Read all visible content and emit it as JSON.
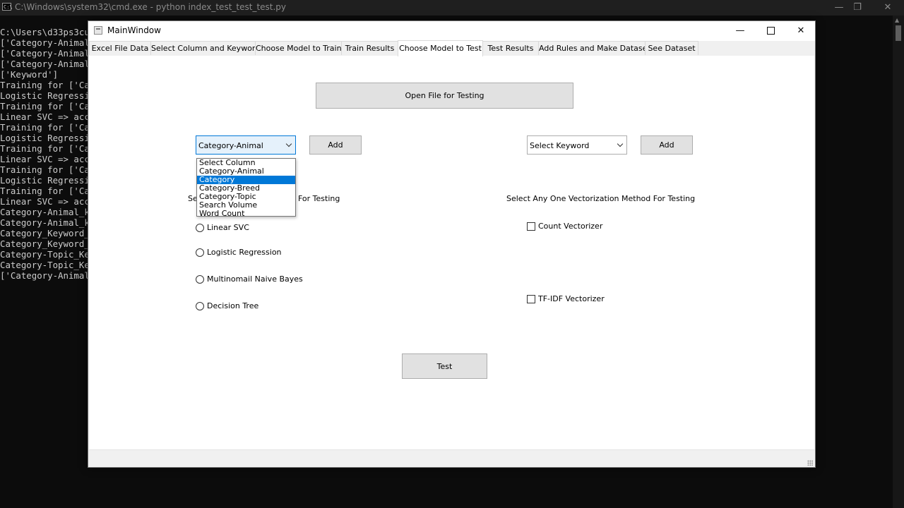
{
  "console": {
    "window_title": "C:\\Windows\\system32\\cmd.exe - python  index_test_test_test.py",
    "icon_text": "C:\\",
    "controls": {
      "minimize": "—",
      "restore": "❐",
      "close": "✕"
    },
    "lines": [
      "C:\\Users\\d33ps3cu",
      "['Category-Animal",
      "['Category-Animal",
      "['Category-Animal",
      "['Keyword']",
      "Training for ['Ca",
      "Logistic Regressi",
      "Training for ['Ca",
      "Linear SVC => acc",
      "Training for ['Ca",
      "Logistic Regressi",
      "Training for ['Ca",
      "Linear SVC => acc",
      "Training for ['Ca",
      "Logistic Regressi",
      "Training for ['Ca",
      "Linear SVC => acc",
      "Category-Animal_k",
      "Category-Animal_k",
      "Category_Keyword_",
      "Category_Keyword_",
      "Category-Topic_Ke",
      "Category-Topic_Ke",
      "['Category-Animal"
    ]
  },
  "main_window": {
    "title": "MainWindow",
    "controls": {
      "minimize": "—",
      "close": "✕"
    },
    "tabs": [
      {
        "label": "Excel File Data"
      },
      {
        "label": "Select Column and Keyword"
      },
      {
        "label": "Choose Model to Train"
      },
      {
        "label": "Train Results"
      },
      {
        "label": "Choose Model to Test",
        "active": true
      },
      {
        "label": "Test Results"
      },
      {
        "label": "Add Rules and Make Dataset"
      },
      {
        "label": "See Dataset"
      }
    ],
    "open_file_button": "Open File for Testing",
    "column_combo": {
      "value": "Category-Animal",
      "options": [
        "Select Column",
        "Category-Animal",
        "Category",
        "Category-Breed",
        "Category-Topic",
        "Search Volume",
        "Word Count"
      ],
      "highlighted_index": 2
    },
    "column_add_button": "Add",
    "keyword_combo": {
      "value": "Select Keyword"
    },
    "keyword_add_button": "Add",
    "model_label_prefix": "Se",
    "model_label_suffix": "For Testing",
    "vectorization_label": "Select Any One Vectorization Method For Testing",
    "models": [
      "Linear SVC",
      "Logistic Regression",
      "Multinomail Naive Bayes",
      "Decision Tree"
    ],
    "vectorizers": [
      "Count Vectorizer",
      "TF-IDF Vectorizer"
    ],
    "test_button": "Test",
    "colors": {
      "selection": "#0078d7",
      "focus_border": "#0078d7",
      "button_face": "#e1e1e1"
    }
  }
}
